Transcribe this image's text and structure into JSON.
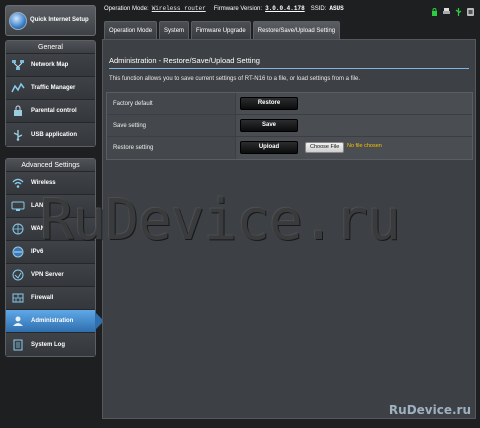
{
  "header": {
    "op_mode_label": "Operation Mode:",
    "op_mode_value": "Wireless router",
    "fw_label": "Firmware Version:",
    "fw_value": "3.0.0.4.178",
    "ssid_label": "SSID:",
    "ssid_value": "ASUS"
  },
  "sidebar": {
    "quick_setup": "Quick Internet Setup",
    "general_title": "General",
    "general_items": [
      {
        "label": "Network Map",
        "icon": "network-map-icon"
      },
      {
        "label": "Traffic Manager",
        "icon": "traffic-icon"
      },
      {
        "label": "Parental control",
        "icon": "parental-icon"
      },
      {
        "label": "USB application",
        "icon": "usb-icon"
      }
    ],
    "advanced_title": "Advanced Settings",
    "advanced_items": [
      {
        "label": "Wireless",
        "icon": "wifi-icon"
      },
      {
        "label": "LAN",
        "icon": "lan-icon"
      },
      {
        "label": "WAN",
        "icon": "wan-icon"
      },
      {
        "label": "IPv6",
        "icon": "ipv6-icon"
      },
      {
        "label": "VPN Server",
        "icon": "vpn-icon"
      },
      {
        "label": "Firewall",
        "icon": "firewall-icon"
      },
      {
        "label": "Administration",
        "icon": "admin-icon",
        "active": true
      },
      {
        "label": "System Log",
        "icon": "log-icon"
      }
    ]
  },
  "tabs": [
    "Operation Mode",
    "System",
    "Firmware Upgrade",
    "Restore/Save/Upload Setting"
  ],
  "main": {
    "title": "Administration - Restore/Save/Upload Setting",
    "description": "This function allows you to save current settings of RT-N16 to a file, or load settings from a file.",
    "rows": [
      {
        "label": "Factory default",
        "button": "Restore"
      },
      {
        "label": "Save setting",
        "button": "Save"
      },
      {
        "label": "Restore setting",
        "button": "Upload"
      }
    ],
    "file_button": "Choose File",
    "file_status": "No file chosen"
  },
  "watermark": {
    "big": "RuDevice.ru",
    "small": "RuDevice.ru"
  },
  "colors": {
    "background": "#1e1f21",
    "panel": "#3d4044",
    "active_nav": "#2f6fae",
    "accent_line": "#7fb3e0",
    "file_status": "#f5c400"
  }
}
